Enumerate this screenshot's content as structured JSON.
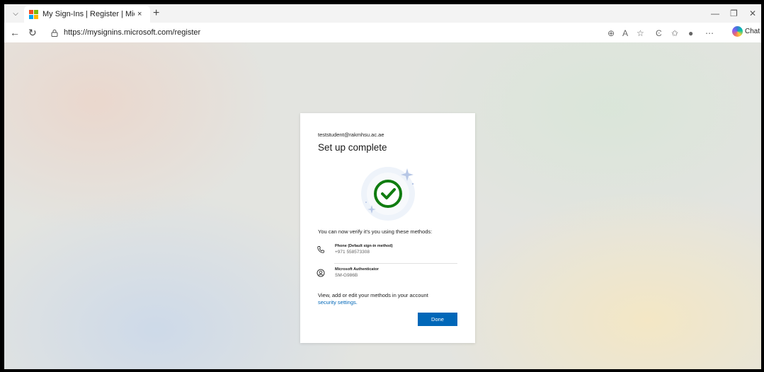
{
  "browser": {
    "tab_title": "My Sign-Ins | Register | Microsoft",
    "tab_close": "×",
    "new_tab": "+",
    "url": "https://mysignins.microsoft.com/register",
    "chat_label": "Chat",
    "icons": [
      "tab-actions-icon",
      "back-icon",
      "refresh-icon",
      "lock-icon",
      "zoom-icon",
      "read-aloud-icon",
      "favorite-icon",
      "extensions-icon",
      "favorites-icon",
      "profile-icon",
      "more-icon",
      "copilot-icon",
      "minimize-icon",
      "restore-icon",
      "close-icon"
    ]
  },
  "card": {
    "email": "teststudent@rakmhsu.ac.ae",
    "title": "Set up complete",
    "lead": "You can now verify it's you using these methods:",
    "methods": [
      {
        "name": "Phone (Default sign-in method)",
        "detail": "+971 558573308",
        "icon": "phone-icon"
      },
      {
        "name": "Microsoft Authenticator",
        "detail": "SM-G986B",
        "icon": "authenticator-icon"
      }
    ],
    "footer_text": "View, add or edit your methods in your account",
    "footer_link": "security settings.",
    "done_label": "Done"
  },
  "colors": {
    "accent": "#0067b8",
    "success": "#107c10"
  }
}
